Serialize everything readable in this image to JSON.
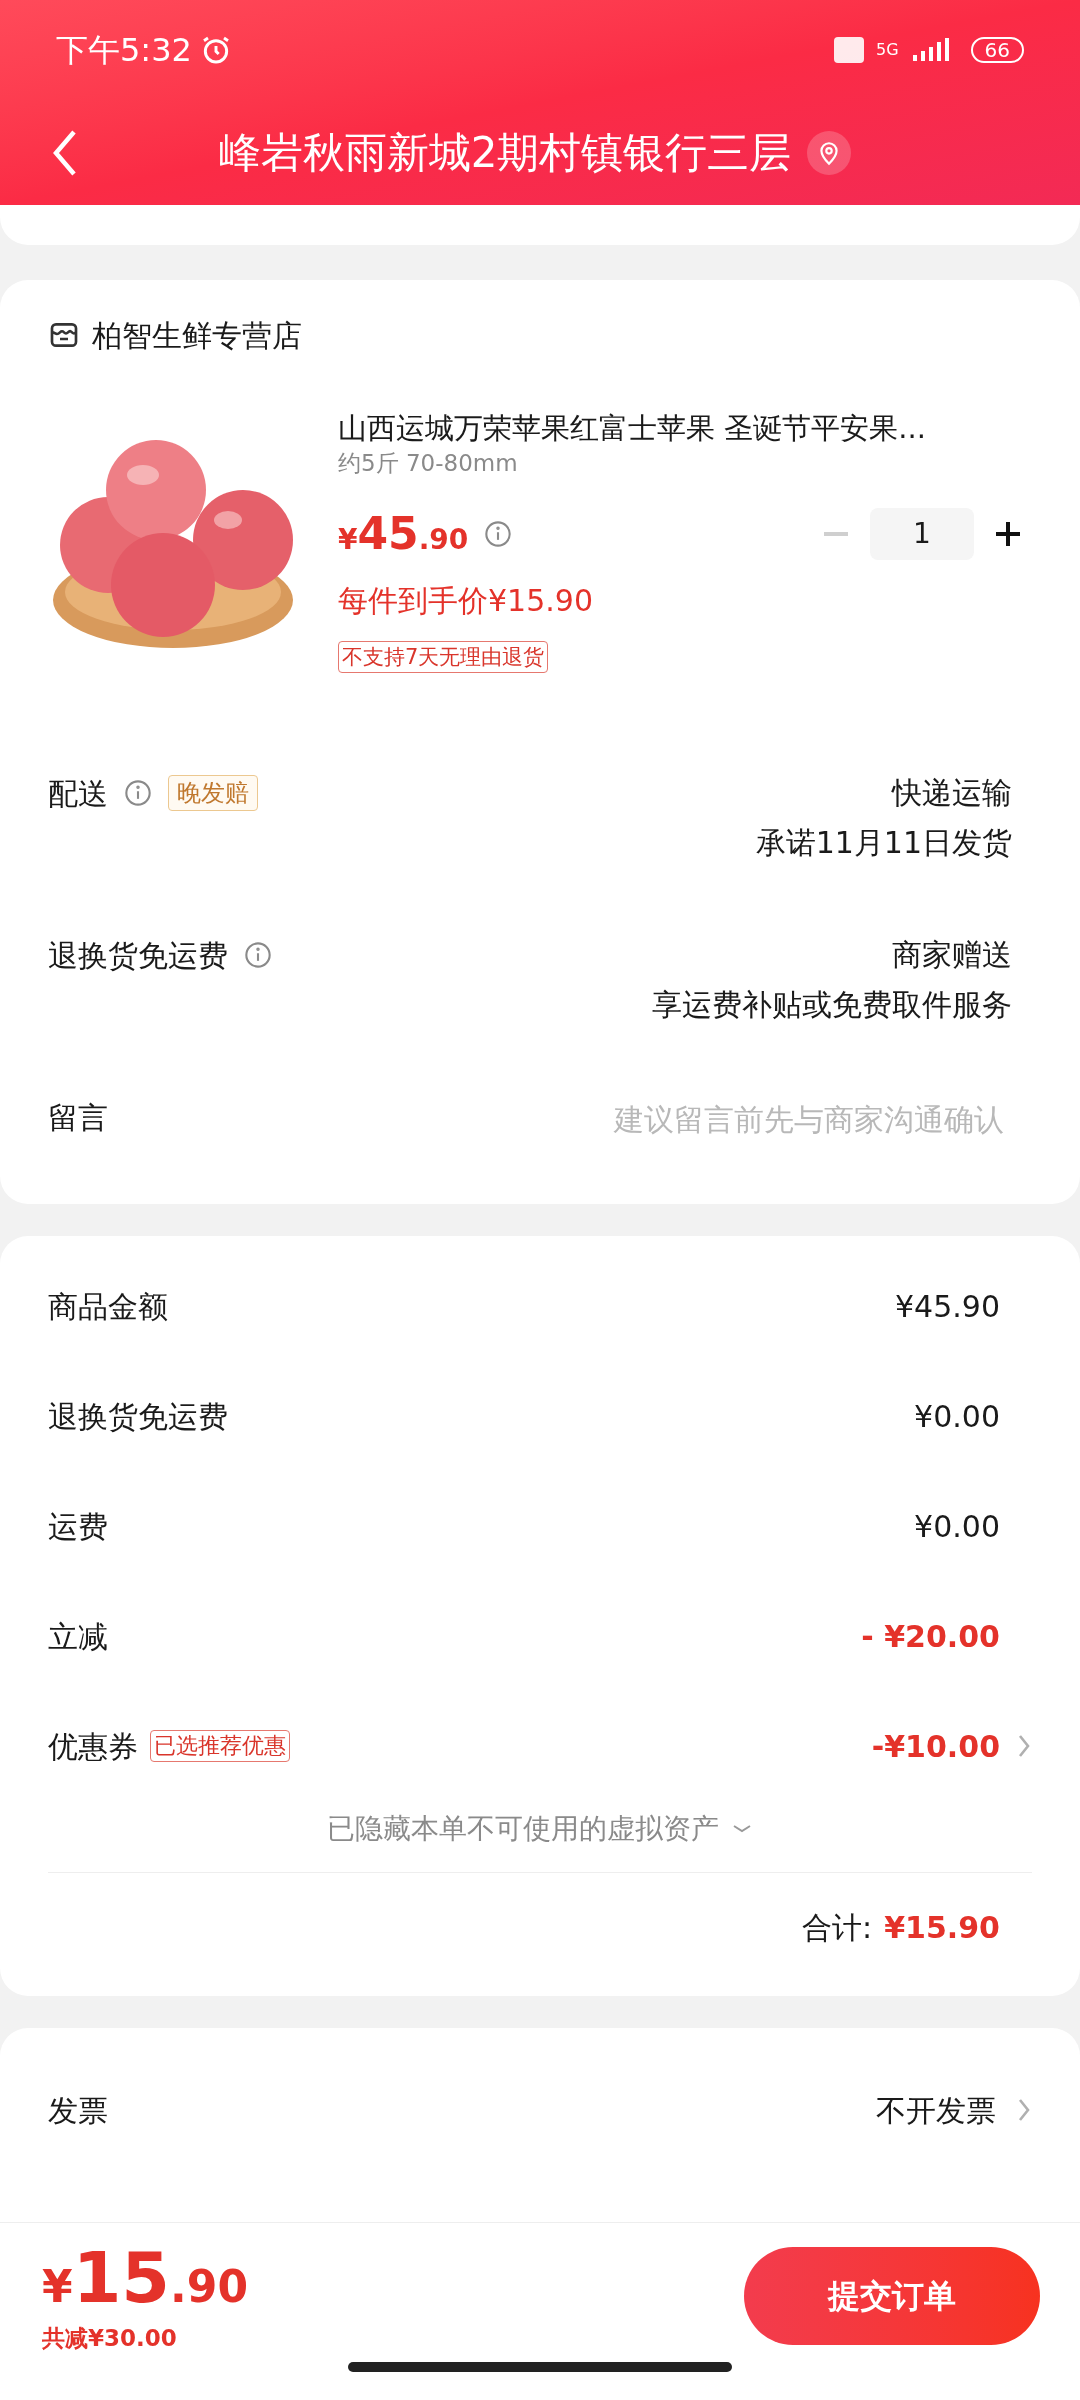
{
  "status_bar": {
    "time": "下午5:32",
    "network": "5G",
    "battery": "66"
  },
  "header": {
    "title": "峰岩秋雨新城2期村镇银行三层"
  },
  "store": {
    "name": "柏智生鲜专营店"
  },
  "product": {
    "title": "山西运城万荣苹果红富士苹果 圣诞节平安果...",
    "spec": "约5斤 70-80mm",
    "currency": "¥",
    "price_int": "45",
    "price_dec": ".90",
    "unit_price": "每件到手价¥15.90",
    "tag": "不支持7天无理由退货",
    "quantity": "1",
    "decrease_disabled": true
  },
  "options": [
    {
      "label": "配送",
      "info": true,
      "badge": "晚发赔",
      "lines": [
        "快递运输",
        "承诺11月11日发货"
      ]
    },
    {
      "label": "退换货免运费",
      "info": true,
      "lines": [
        "商家赠送",
        "享运费补贴或免费取件服务"
      ]
    },
    {
      "label": "留言",
      "info": false,
      "placeholder": "建议留言前先与商家沟通确认"
    }
  ],
  "summary": {
    "rows": [
      {
        "label": "商品金额",
        "value": "¥45.90",
        "discount": false,
        "arrow": false
      },
      {
        "label": "退换货免运费",
        "value": "¥0.00",
        "discount": false,
        "arrow": false
      },
      {
        "label": "运费",
        "value": "¥0.00",
        "discount": false,
        "arrow": false
      },
      {
        "label": "立减",
        "value": "- ¥20.00",
        "discount": true,
        "arrow": false
      },
      {
        "label": "优惠券",
        "badge": "已选推荐优惠",
        "value": "-¥10.00",
        "discount": true,
        "arrow": true
      }
    ],
    "hidden_note": "已隐藏本单不可使用的虚拟资产",
    "total_label": "合计:",
    "total_value": "¥15.90"
  },
  "invoice": {
    "label": "发票",
    "value": "不开发票"
  },
  "bottom_bar": {
    "currency": "¥",
    "price_int": "15",
    "price_dec": ".90",
    "saved": "共减¥30.00",
    "submit": "提交订单"
  }
}
